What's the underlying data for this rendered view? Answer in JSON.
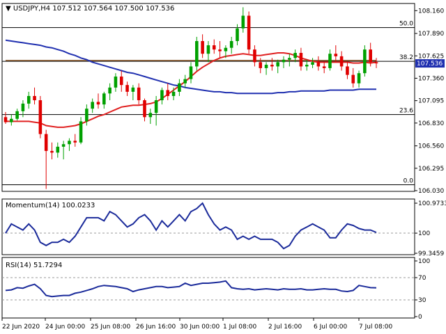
{
  "header": {
    "symbol": "USDJPY,H4",
    "ohlc": "107.512 107.564 107.500 107.536"
  },
  "price_axis_ticks": [
    "108.160",
    "107.890",
    "107.625",
    "107.360",
    "107.095",
    "106.830",
    "106.560",
    "106.295",
    "106.030"
  ],
  "current_price": "107.536",
  "fib": [
    {
      "label": "50.0",
      "value": 107.96
    },
    {
      "label": "38.2",
      "value": 107.56
    },
    {
      "label": "23.6",
      "value": 106.93
    },
    {
      "label": "0.0",
      "value": 106.1
    }
  ],
  "momentum": {
    "label": "Momentum(14) 100.0233",
    "ticks": [
      "100.9733",
      "100",
      "99.3459"
    ],
    "ref_level": 100
  },
  "rsi": {
    "label": "RSI(14) 51.7294",
    "ticks": [
      "100",
      "70",
      "30",
      "0"
    ],
    "levels": [
      70,
      30
    ]
  },
  "time_labels": [
    "22 Jun 2020",
    "24 Jun 00:00",
    "25 Jun 08:00",
    "26 Jun 16:00",
    "30 Jun 00:00",
    "1 Jul 08:00",
    "2 Jul 16:00",
    "6 Jul 00:00",
    "7 Jul 08:00"
  ],
  "colors": {
    "bull": "#00a000",
    "bear": "#e00000",
    "ma_fast": "#e02020",
    "ma_slow": "#2030b0",
    "ma_mid": "#8b5a2b",
    "fib_line": "#000000",
    "osc_line": "#1a2a9a",
    "price_box": "#2030b0"
  },
  "chart_data": {
    "type": "candlestick",
    "title": "USDJPY,H4",
    "ylim": [
      106.03,
      108.22
    ],
    "candles": [
      [
        106.9,
        106.96,
        106.82,
        106.84
      ],
      [
        106.84,
        106.93,
        106.8,
        106.88
      ],
      [
        106.88,
        107.0,
        106.86,
        106.97
      ],
      [
        106.97,
        107.1,
        106.9,
        107.06
      ],
      [
        107.06,
        107.2,
        107.0,
        107.15
      ],
      [
        107.15,
        107.25,
        107.05,
        107.1
      ],
      [
        107.1,
        107.15,
        106.65,
        106.7
      ],
      [
        106.7,
        106.75,
        106.05,
        106.5
      ],
      [
        106.5,
        106.6,
        106.4,
        106.48
      ],
      [
        106.48,
        106.6,
        106.42,
        106.55
      ],
      [
        106.55,
        106.62,
        106.4,
        106.58
      ],
      [
        106.58,
        106.65,
        106.5,
        106.62
      ],
      [
        106.62,
        106.7,
        106.55,
        106.6
      ],
      [
        106.6,
        106.9,
        106.58,
        106.85
      ],
      [
        106.85,
        107.05,
        106.8,
        107.0
      ],
      [
        107.0,
        107.12,
        106.95,
        107.08
      ],
      [
        107.08,
        107.18,
        107.0,
        107.05
      ],
      [
        107.05,
        107.2,
        107.0,
        107.18
      ],
      [
        107.18,
        107.3,
        107.1,
        107.25
      ],
      [
        107.25,
        107.42,
        107.2,
        107.38
      ],
      [
        107.38,
        107.45,
        107.2,
        107.28
      ],
      [
        107.28,
        107.32,
        107.15,
        107.2
      ],
      [
        107.2,
        107.28,
        107.1,
        107.25
      ],
      [
        107.25,
        107.3,
        107.05,
        107.1
      ],
      [
        107.1,
        107.12,
        106.85,
        106.9
      ],
      [
        106.9,
        107.0,
        106.82,
        106.95
      ],
      [
        106.95,
        107.15,
        106.8,
        107.1
      ],
      [
        107.1,
        107.25,
        107.05,
        107.22
      ],
      [
        107.22,
        107.3,
        107.1,
        107.15
      ],
      [
        107.15,
        107.25,
        107.1,
        107.2
      ],
      [
        107.2,
        107.35,
        107.15,
        107.3
      ],
      [
        107.3,
        107.4,
        107.25,
        107.35
      ],
      [
        107.35,
        107.55,
        107.3,
        107.5
      ],
      [
        107.5,
        107.85,
        107.45,
        107.8
      ],
      [
        107.8,
        107.88,
        107.6,
        107.65
      ],
      [
        107.65,
        107.8,
        107.55,
        107.75
      ],
      [
        107.75,
        107.82,
        107.65,
        107.7
      ],
      [
        107.7,
        107.8,
        107.6,
        107.68
      ],
      [
        107.68,
        107.75,
        107.6,
        107.72
      ],
      [
        107.72,
        107.85,
        107.65,
        107.8
      ],
      [
        107.8,
        108.0,
        107.75,
        107.95
      ],
      [
        107.95,
        108.2,
        107.9,
        108.1
      ],
      [
        108.1,
        108.15,
        107.65,
        107.7
      ],
      [
        107.7,
        107.75,
        107.5,
        107.55
      ],
      [
        107.55,
        107.6,
        107.42,
        107.48
      ],
      [
        107.48,
        107.55,
        107.4,
        107.52
      ],
      [
        107.52,
        107.6,
        107.45,
        107.5
      ],
      [
        107.5,
        107.58,
        107.42,
        107.55
      ],
      [
        107.55,
        107.62,
        107.48,
        107.58
      ],
      [
        107.58,
        107.65,
        107.5,
        107.6
      ],
      [
        107.6,
        107.7,
        107.55,
        107.66
      ],
      [
        107.66,
        107.72,
        107.45,
        107.5
      ],
      [
        107.5,
        107.58,
        107.45,
        107.52
      ],
      [
        107.52,
        107.6,
        107.48,
        107.55
      ],
      [
        107.55,
        107.62,
        107.45,
        107.5
      ],
      [
        107.5,
        107.55,
        107.42,
        107.48
      ],
      [
        107.48,
        107.7,
        107.45,
        107.65
      ],
      [
        107.65,
        107.75,
        107.55,
        107.62
      ],
      [
        107.62,
        107.68,
        107.45,
        107.5
      ],
      [
        107.5,
        107.55,
        107.35,
        107.4
      ],
      [
        107.4,
        107.48,
        107.25,
        107.3
      ],
      [
        107.3,
        107.45,
        107.25,
        107.42
      ],
      [
        107.42,
        107.75,
        107.38,
        107.7
      ],
      [
        107.7,
        107.78,
        107.5,
        107.55
      ],
      [
        107.55,
        107.6,
        107.48,
        107.536
      ]
    ],
    "sma_fast": [
      106.85,
      106.85,
      106.85,
      106.85,
      106.85,
      106.84,
      106.83,
      106.8,
      106.79,
      106.78,
      106.78,
      106.79,
      106.8,
      106.82,
      106.85,
      106.88,
      106.91,
      106.93,
      106.96,
      106.99,
      107.02,
      107.03,
      107.04,
      107.04,
      107.05,
      107.06,
      107.08,
      107.12,
      107.17,
      107.22,
      107.27,
      107.32,
      107.38,
      107.44,
      107.49,
      107.53,
      107.57,
      107.6,
      107.62,
      107.63,
      107.64,
      107.65,
      107.64,
      107.63,
      107.63,
      107.64,
      107.65,
      107.66,
      107.66,
      107.65,
      107.63,
      107.6,
      107.58,
      107.56,
      107.55,
      107.55,
      107.55,
      107.55,
      107.55,
      107.55,
      107.54,
      107.54,
      107.55,
      107.54,
      107.55
    ],
    "sma_slow": [
      107.81,
      107.8,
      107.79,
      107.78,
      107.77,
      107.76,
      107.75,
      107.73,
      107.72,
      107.7,
      107.68,
      107.65,
      107.63,
      107.6,
      107.58,
      107.55,
      107.53,
      107.51,
      107.49,
      107.47,
      107.45,
      107.43,
      107.42,
      107.4,
      107.38,
      107.36,
      107.34,
      107.32,
      107.3,
      107.28,
      107.27,
      107.25,
      107.24,
      107.23,
      107.22,
      107.21,
      107.2,
      107.2,
      107.19,
      107.19,
      107.18,
      107.18,
      107.18,
      107.18,
      107.18,
      107.18,
      107.18,
      107.19,
      107.19,
      107.2,
      107.2,
      107.21,
      107.21,
      107.21,
      107.21,
      107.21,
      107.22,
      107.22,
      107.22,
      107.22,
      107.22,
      107.23,
      107.23,
      107.23,
      107.23
    ],
    "sma_mid_level": 107.57,
    "momentum": [
      100.0,
      100.3,
      100.2,
      100.1,
      100.3,
      100.1,
      99.7,
      99.6,
      99.7,
      99.7,
      99.8,
      99.7,
      99.9,
      100.2,
      100.5,
      100.5,
      100.5,
      100.4,
      100.7,
      100.6,
      100.4,
      100.2,
      100.3,
      100.5,
      100.6,
      100.4,
      100.1,
      100.4,
      100.2,
      100.4,
      100.6,
      100.4,
      100.7,
      100.8,
      100.9733,
      100.6,
      100.3,
      100.1,
      100.2,
      100.1,
      99.8,
      99.9,
      99.8,
      99.9,
      99.8,
      99.8,
      99.8,
      99.7,
      99.5,
      99.6,
      99.9,
      100.1,
      100.2,
      100.3,
      100.2,
      100.1,
      99.85,
      99.85,
      100.1,
      100.3,
      100.25,
      100.15,
      100.1,
      100.1,
      100.0233
    ],
    "rsi": [
      47,
      48,
      52,
      51,
      55,
      58,
      50,
      38,
      36,
      37,
      38,
      38,
      42,
      44,
      47,
      50,
      54,
      56,
      55,
      54,
      52,
      50,
      45,
      48,
      50,
      52,
      54,
      54,
      52,
      53,
      54,
      60,
      56,
      58,
      60,
      60,
      61,
      62,
      64,
      52,
      50,
      49,
      50,
      48,
      49,
      50,
      49,
      48,
      50,
      49,
      49,
      50,
      48,
      48,
      49,
      50,
      49,
      49,
      46,
      45,
      47,
      56,
      54,
      52,
      51.7294
    ]
  }
}
